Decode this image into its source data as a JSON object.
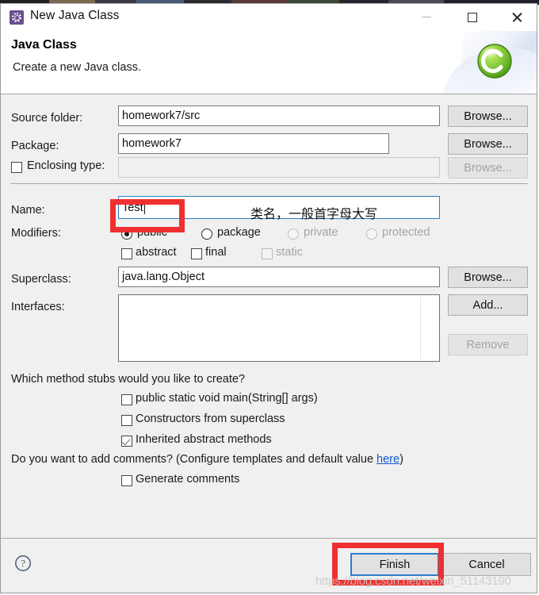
{
  "window": {
    "title": "New Java Class",
    "icon": "eclipse-wizard-icon",
    "minimize_label": "Minimize",
    "maximize_label": "Maximize",
    "close_label": "Close"
  },
  "header": {
    "title": "Java Class",
    "description": "Create a new Java class.",
    "banner_icon": "java-class-green-ball-icon"
  },
  "form": {
    "source_folder": {
      "label": "Source folder:",
      "value": "homework7/src",
      "button": "Browse..."
    },
    "package": {
      "label": "Package:",
      "value": "homework7",
      "button": "Browse..."
    },
    "enclosing_type": {
      "label": "Enclosing type:",
      "checked": false,
      "value": "",
      "button": "Browse..."
    },
    "name": {
      "label": "Name:",
      "value": "Test"
    },
    "modifiers": {
      "label": "Modifiers:",
      "access": [
        {
          "label": "public",
          "selected": true,
          "enabled": true
        },
        {
          "label": "package",
          "selected": false,
          "enabled": true
        },
        {
          "label": "private",
          "selected": false,
          "enabled": false
        },
        {
          "label": "protected",
          "selected": false,
          "enabled": false
        }
      ],
      "flags": [
        {
          "label": "abstract",
          "checked": false,
          "enabled": true
        },
        {
          "label": "final",
          "checked": false,
          "enabled": true
        },
        {
          "label": "static",
          "checked": false,
          "enabled": false
        }
      ]
    },
    "superclass": {
      "label": "Superclass:",
      "value": "java.lang.Object",
      "button": "Browse..."
    },
    "interfaces": {
      "label": "Interfaces:",
      "items": [],
      "add_button": "Add...",
      "remove_button": "Remove"
    },
    "stubs": {
      "question": "Which method stubs would you like to create?",
      "options": [
        {
          "label": "public static void main(String[] args)",
          "checked": false
        },
        {
          "label": "Constructors from superclass",
          "checked": false
        },
        {
          "label": "Inherited abstract methods",
          "checked": true
        }
      ]
    },
    "comments": {
      "question_prefix": "Do you want to add comments? (Configure templates and default value ",
      "link": "here",
      "question_suffix": ")",
      "option": {
        "label": "Generate comments",
        "checked": false
      }
    }
  },
  "footer": {
    "help_icon": "help-question-icon",
    "finish_button": "Finish",
    "cancel_button": "Cancel"
  },
  "annotations": {
    "name_note": "类名，一般首字母大写",
    "highlight_color": "#f03030"
  },
  "watermark": "https://blog.csdn.net/weixin_51143190"
}
